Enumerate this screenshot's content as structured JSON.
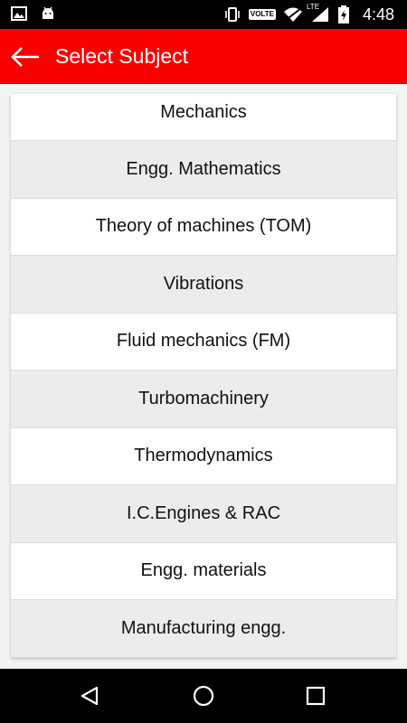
{
  "status_bar": {
    "time": "4:48",
    "volte": "VOLTE",
    "network": "LTE",
    "icons": [
      "image-icon",
      "android-icon",
      "vibrate-icon",
      "volte-icon",
      "wifi-icon",
      "signal-icon",
      "battery-charging-icon"
    ]
  },
  "app_bar": {
    "title": "Select Subject",
    "back_icon": "arrow-left-icon",
    "color": "#fb0000"
  },
  "subjects": [
    "Mechanics",
    "Engg. Mathematics",
    "Theory of machines (TOM)",
    "Vibrations",
    "Fluid mechanics (FM)",
    "Turbomachinery",
    "Thermodynamics",
    "I.C.Engines & RAC",
    "Engg. materials",
    "Manufacturing engg."
  ],
  "nav_bar": {
    "icons": [
      "back-triangle-icon",
      "home-circle-icon",
      "recents-square-icon"
    ]
  }
}
